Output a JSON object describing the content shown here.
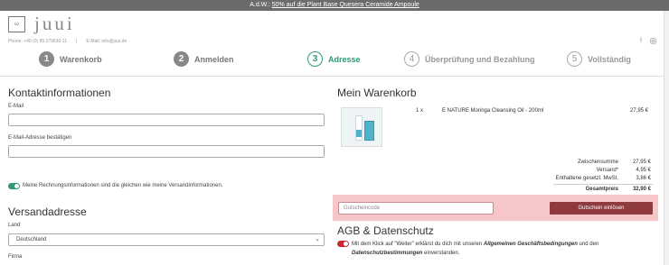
{
  "topbar": {
    "prefix": "A.d.W.:",
    "link": "50% auf die Plant Base Quesera Ceramide Ampoule"
  },
  "brand": {
    "logo_text": "juui",
    "logo_icon_text": "ω"
  },
  "contact": {
    "phone": "Phone: +49 (0) 89 379630-11",
    "separator": "|",
    "email": "E-Mail: info@juui.de"
  },
  "social": {
    "facebook_icon": "facebook-icon",
    "instagram_icon": "instagram-icon"
  },
  "steps": [
    {
      "num": "1",
      "label": "Warenkorb",
      "state": "done"
    },
    {
      "num": "2",
      "label": "Anmelden",
      "state": "done"
    },
    {
      "num": "3",
      "label": "Adresse",
      "state": "active"
    },
    {
      "num": "4",
      "label": "Überprüfung und Bezahlung",
      "state": "todo"
    },
    {
      "num": "5",
      "label": "Vollständig",
      "state": "todo"
    }
  ],
  "contact_form": {
    "heading": "Kontaktinformationen",
    "email_label": "E-Mail",
    "email_value": "",
    "email_confirm_label": "E-Mail-Adresse bestätigen",
    "email_confirm_value": "",
    "toggle_text": "Meine Rechnungsinformationen sind die gleichen wie meine Versandinformationen."
  },
  "shipping": {
    "heading": "Versandadresse",
    "country_label": "Land",
    "country_value": "Deutschland",
    "company_label": "Firma"
  },
  "cart": {
    "heading": "Mein Warenkorb",
    "item_qty": "1 x",
    "item_name": "E NATURE Moringa Cleansing Oil - 200ml",
    "item_price": "27,95 €",
    "summary": [
      {
        "label": "Zwischensumme",
        "value": "27,95 €",
        "bold": false
      },
      {
        "label": "Versand*",
        "value": "4,95 €",
        "bold": false
      },
      {
        "label": "Enthaltene gesetzl. MwSt.",
        "value": "3,86 €",
        "bold": false
      },
      {
        "label": "Gesamtpreis",
        "value": "32,90 €",
        "bold": true
      }
    ]
  },
  "coupon": {
    "placeholder": "Gutscheincode",
    "button": "Gutschein einlösen"
  },
  "agb": {
    "heading": "AGB & Datenschutz",
    "text_1": "Mit dem Klick auf \"Weiter\" erklärst du dich mit unseren ",
    "link_1": "Allgemeinen Geschäftsbedingungen",
    "text_2": " und den ",
    "link_2": "Datenschutzbestimmungen",
    "text_3": " einverstanden."
  },
  "colors": {
    "accent": "#2e9a78",
    "coupon_bg": "#f7c6c9",
    "coupon_button": "#8e3a3e",
    "toggle_red": "#d0252f"
  }
}
